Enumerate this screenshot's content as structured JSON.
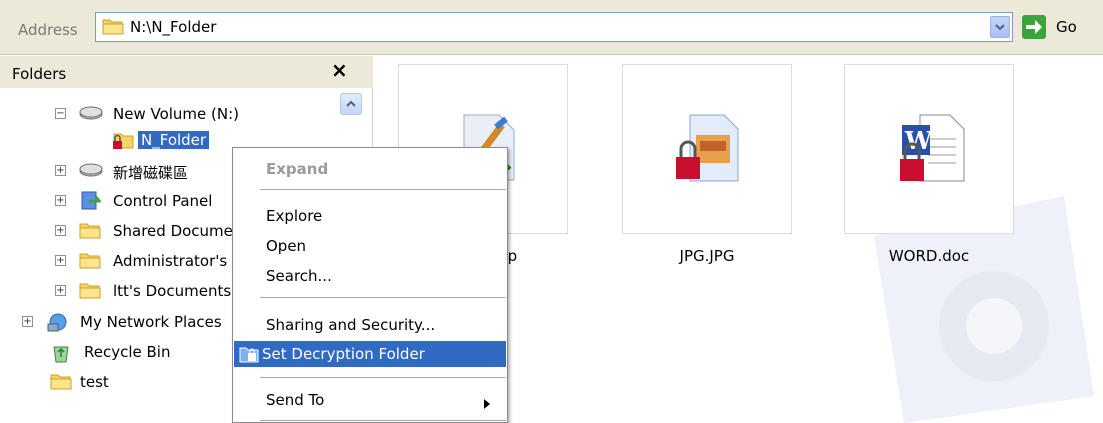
{
  "address_bar": {
    "label": "Address",
    "value": "N:\\N_Folder",
    "go_label": "Go"
  },
  "folders_pane": {
    "title": "Folders",
    "close_symbol": "×",
    "tree": [
      {
        "label": "New Volume (N:)",
        "icon": "drive-icon",
        "expander": "⊟"
      },
      {
        "label": "N_Folder",
        "icon": "locked-folder-icon",
        "selected": true
      },
      {
        "label": "新增磁碟區",
        "icon": "drive-icon",
        "expander": "+"
      },
      {
        "label": "Control Panel",
        "icon": "control-panel-icon",
        "expander": "+"
      },
      {
        "label": "Shared Documents",
        "icon": "folder-icon",
        "expander": "+"
      },
      {
        "label": "Administrator's Documents",
        "icon": "folder-icon",
        "expander": "+"
      },
      {
        "label": "ltt's Documents",
        "icon": "folder-icon",
        "expander": "+"
      },
      {
        "label": "My Network Places",
        "icon": "network-icon",
        "expander": "+"
      },
      {
        "label": "Recycle Bin",
        "icon": "recycle-bin-icon"
      },
      {
        "label": "test",
        "icon": "folder-icon"
      }
    ]
  },
  "files": [
    {
      "name": "BMP.bmp",
      "icon": "locked-bitmap-icon"
    },
    {
      "name": "JPG.JPG",
      "icon": "locked-jpg-icon"
    },
    {
      "name": "WORD.doc",
      "icon": "locked-word-icon"
    }
  ],
  "context_menu": {
    "items": [
      {
        "label": "Expand",
        "disabled": true
      },
      {
        "label": "Explore"
      },
      {
        "label": "Open"
      },
      {
        "label": "Search..."
      },
      {
        "label": "Sharing and Security..."
      },
      {
        "label": "Set Decryption Folder",
        "highlighted": true,
        "icon": "lock-folder-icon"
      },
      {
        "label": "Send To",
        "submenu": true
      }
    ]
  },
  "colors": {
    "selection": "#316ac5",
    "chrome": "#ece9d8",
    "lock_red": "#c8102e"
  }
}
